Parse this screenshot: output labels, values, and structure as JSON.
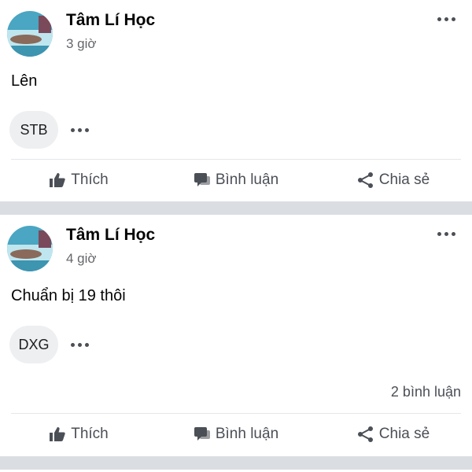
{
  "posts": [
    {
      "author": "Tâm Lí Học",
      "time": "3 giờ",
      "content": "Lên",
      "tag": "STB",
      "comment_count": "",
      "actions": {
        "like": "Thích",
        "comment": "Bình luận",
        "share": "Chia sẻ"
      }
    },
    {
      "author": "Tâm Lí Học",
      "time": "4 giờ",
      "content": "Chuẩn bị 19 thôi",
      "tag": "DXG",
      "comment_count": "2 bình luận",
      "actions": {
        "like": "Thích",
        "comment": "Bình luận",
        "share": "Chia sẻ"
      }
    }
  ],
  "icons": {
    "like": "thumbs-up-icon",
    "comment": "speech-bubble-icon",
    "share": "share-icon",
    "more": "more-horizontal-icon"
  },
  "colors": {
    "separator": "#dadde1",
    "secondary_text": "#65676b",
    "action_text": "#4b4f56",
    "tag_background": "#eeeff1"
  }
}
